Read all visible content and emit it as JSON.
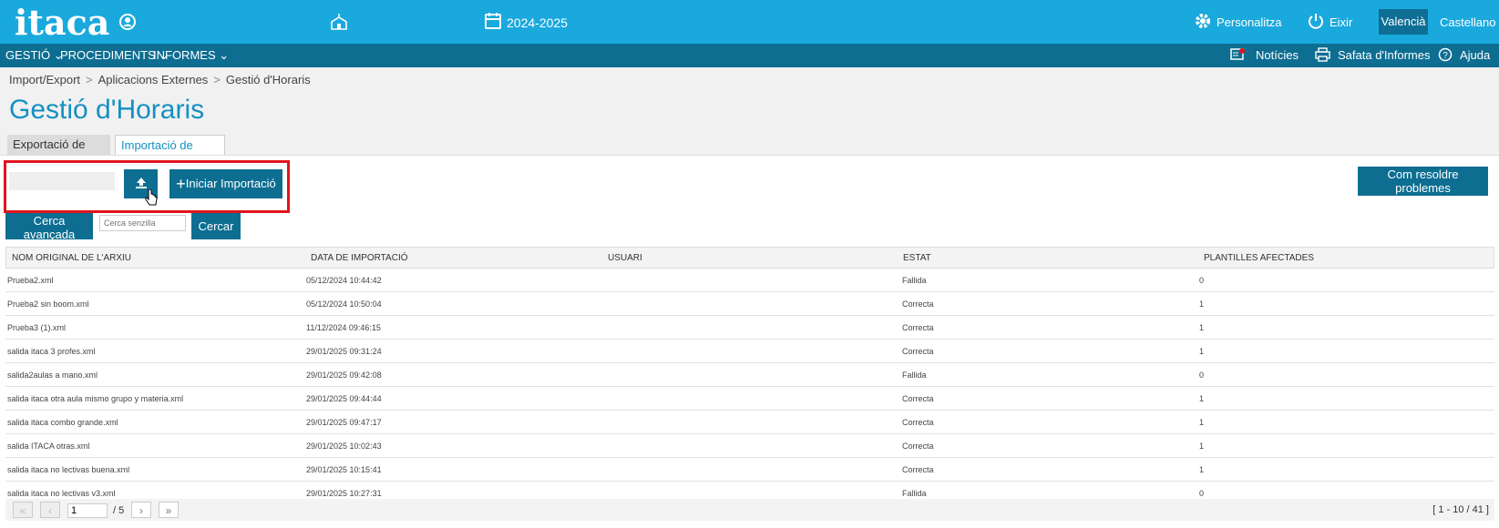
{
  "app": {
    "logo": "itaca"
  },
  "topbar": {
    "year": "2024-2025",
    "personalize": "Personalitza",
    "exit": "Eixir",
    "lang_active": "Valencià",
    "lang_other": "Castellano"
  },
  "menu": {
    "items": [
      "GESTIÓ",
      "PROCEDIMENTS",
      "INFORMES"
    ],
    "news": "Notícies",
    "reports_tray": "Safata d'Informes",
    "help": "Ajuda"
  },
  "breadcrumb": [
    "Import/Export",
    "Aplicacions Externes",
    "Gestió d'Horaris"
  ],
  "page_title": "Gestió d'Horaris",
  "tabs": [
    "Exportació de horaris",
    "Importació de horaris"
  ],
  "actions": {
    "start_import": "Iniciar Importació",
    "resolve": "Com resoldre problemes",
    "advanced_search": "Cerca avançada",
    "simple_search_placeholder": "Cerca senzilla",
    "search": "Cercar"
  },
  "table": {
    "columns": [
      "NOM ORIGINAL DE L'ARXIU",
      "DATA DE IMPORTACIÓ",
      "USUARI",
      "ESTAT",
      "PLANTILLES AFECTADES"
    ],
    "rows": [
      [
        "Prueba2.xml",
        "05/12/2024 10:44:42",
        "",
        "Fallida",
        "0"
      ],
      [
        "Prueba2 sin boom.xml",
        "05/12/2024 10:50:04",
        "",
        "Correcta",
        "1"
      ],
      [
        "Prueba3 (1).xml",
        "11/12/2024 09:46:15",
        "",
        "Correcta",
        "1"
      ],
      [
        "salida itaca 3 profes.xml",
        "29/01/2025 09:31:24",
        "",
        "Correcta",
        "1"
      ],
      [
        "salida2aulas a mano.xml",
        "29/01/2025 09:42:08",
        "",
        "Fallida",
        "0"
      ],
      [
        "salida itaca otra aula mismo grupo y materia.xml",
        "29/01/2025 09:44:44",
        "",
        "Correcta",
        "1"
      ],
      [
        "salida itaca combo grande.xml",
        "29/01/2025 09:47:17",
        "",
        "Correcta",
        "1"
      ],
      [
        "salida ITACA otras.xml",
        "29/01/2025 10:02:43",
        "",
        "Correcta",
        "1"
      ],
      [
        "salida itaca no lectivas buena.xml",
        "29/01/2025 10:15:41",
        "",
        "Correcta",
        "1"
      ],
      [
        "salida itaca no lectivas v3.xml",
        "29/01/2025 10:27:31",
        "",
        "Fallida",
        "0"
      ]
    ]
  },
  "pager": {
    "page": "1",
    "total": "/ 5",
    "range": "[ 1 - 10 / 41 ]"
  },
  "colors": {
    "topbar": "#1aa9dd",
    "menubar": "#0d6e92",
    "accent": "#1590c2",
    "highlight": "#e0141e"
  }
}
